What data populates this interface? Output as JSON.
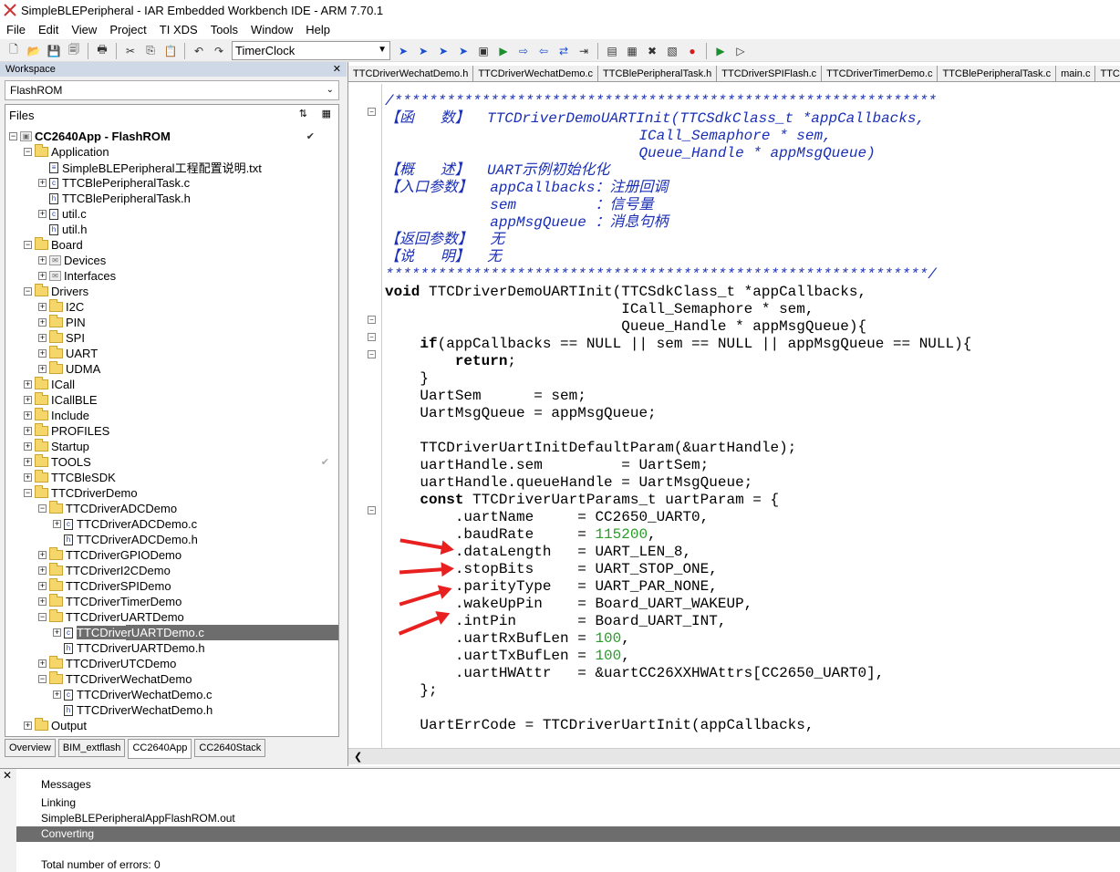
{
  "window": {
    "title": "SimpleBLEPeripheral - IAR Embedded Workbench IDE - ARM 7.70.1"
  },
  "menu": [
    "File",
    "Edit",
    "View",
    "Project",
    "TI XDS",
    "Tools",
    "Window",
    "Help"
  ],
  "toolbar": {
    "combo_value": "TimerClock"
  },
  "workspace": {
    "title": "Workspace",
    "config": "FlashROM",
    "files_header": "Files",
    "project": "CC2640App - FlashROM",
    "tabs": [
      "Overview",
      "BIM_extflash",
      "CC2640App",
      "CC2640Stack"
    ],
    "tree": [
      {
        "label": "Application",
        "level": 1,
        "type": "folder",
        "exp": "-"
      },
      {
        "label": "SimpleBLEPeripheral工程配置说明.txt",
        "level": 2,
        "type": "file",
        "exp": ""
      },
      {
        "label": "TTCBlePeripheralTask.c",
        "level": 2,
        "type": "file",
        "exp": "+"
      },
      {
        "label": "TTCBlePeripheralTask.h",
        "level": 2,
        "type": "file",
        "exp": ""
      },
      {
        "label": "util.c",
        "level": 2,
        "type": "file",
        "exp": "+"
      },
      {
        "label": "util.h",
        "level": 2,
        "type": "file",
        "exp": ""
      },
      {
        "label": "Board",
        "level": 1,
        "type": "folder",
        "exp": "-"
      },
      {
        "label": "Devices",
        "level": 2,
        "type": "group",
        "exp": "+"
      },
      {
        "label": "Interfaces",
        "level": 2,
        "type": "group",
        "exp": "+"
      },
      {
        "label": "Drivers",
        "level": 1,
        "type": "folder",
        "exp": "-"
      },
      {
        "label": "I2C",
        "level": 2,
        "type": "folder",
        "exp": "+"
      },
      {
        "label": "PIN",
        "level": 2,
        "type": "folder",
        "exp": "+"
      },
      {
        "label": "SPI",
        "level": 2,
        "type": "folder",
        "exp": "+"
      },
      {
        "label": "UART",
        "level": 2,
        "type": "folder",
        "exp": "+"
      },
      {
        "label": "UDMA",
        "level": 2,
        "type": "folder",
        "exp": "+"
      },
      {
        "label": "ICall",
        "level": 1,
        "type": "folder",
        "exp": "+"
      },
      {
        "label": "ICallBLE",
        "level": 1,
        "type": "folder",
        "exp": "+"
      },
      {
        "label": "Include",
        "level": 1,
        "type": "folder",
        "exp": "+"
      },
      {
        "label": "PROFILES",
        "level": 1,
        "type": "folder",
        "exp": "+"
      },
      {
        "label": "Startup",
        "level": 1,
        "type": "folder",
        "exp": "+"
      },
      {
        "label": "TOOLS",
        "level": 1,
        "type": "folder",
        "exp": "+"
      },
      {
        "label": "TTCBleSDK",
        "level": 1,
        "type": "folder",
        "exp": "+"
      },
      {
        "label": "TTCDriverDemo",
        "level": 1,
        "type": "folder",
        "exp": "-"
      },
      {
        "label": "TTCDriverADCDemo",
        "level": 2,
        "type": "folder",
        "exp": "-"
      },
      {
        "label": "TTCDriverADCDemo.c",
        "level": 3,
        "type": "file",
        "exp": "+"
      },
      {
        "label": "TTCDriverADCDemo.h",
        "level": 3,
        "type": "file",
        "exp": ""
      },
      {
        "label": "TTCDriverGPIODemo",
        "level": 2,
        "type": "folder",
        "exp": "+"
      },
      {
        "label": "TTCDriverI2CDemo",
        "level": 2,
        "type": "folder",
        "exp": "+"
      },
      {
        "label": "TTCDriverSPIDemo",
        "level": 2,
        "type": "folder",
        "exp": "+"
      },
      {
        "label": "TTCDriverTimerDemo",
        "level": 2,
        "type": "folder",
        "exp": "+"
      },
      {
        "label": "TTCDriverUARTDemo",
        "level": 2,
        "type": "folder",
        "exp": "-"
      },
      {
        "label": "TTCDriverUARTDemo.c",
        "level": 3,
        "type": "file",
        "exp": "+",
        "selected": true
      },
      {
        "label": "TTCDriverUARTDemo.h",
        "level": 3,
        "type": "file",
        "exp": ""
      },
      {
        "label": "TTCDriverUTCDemo",
        "level": 2,
        "type": "folder",
        "exp": "+"
      },
      {
        "label": "TTCDriverWechatDemo",
        "level": 2,
        "type": "folder",
        "exp": "-"
      },
      {
        "label": "TTCDriverWechatDemo.c",
        "level": 3,
        "type": "file",
        "exp": "+"
      },
      {
        "label": "TTCDriverWechatDemo.h",
        "level": 3,
        "type": "file",
        "exp": ""
      },
      {
        "label": "Output",
        "level": 1,
        "type": "folder",
        "exp": "+"
      }
    ]
  },
  "editor": {
    "tabs": [
      "TTCDriverWechatDemo.h",
      "TTCDriverWechatDemo.c",
      "TTCBlePeripheralTask.h",
      "TTCDriverSPIFlash.c",
      "TTCDriverTimerDemo.c",
      "TTCBlePeripheralTask.c",
      "main.c",
      "TTCDriverTim"
    ],
    "lines": [
      {
        "t": "/**************************************************************",
        "c": "cm"
      },
      {
        "t": "【函   数】  TTCDriverDemoUARTInit(TTCSdkClass_t *appCallbacks,",
        "c": "cm"
      },
      {
        "t": "                             ICall_Semaphore * sem,",
        "c": "cm"
      },
      {
        "t": "                             Queue_Handle * appMsgQueue)",
        "c": "cm"
      },
      {
        "t": "【概   述】  UART示例初始化化",
        "c": "cm"
      },
      {
        "t": "【入口参数】  appCallbacks：注册回调",
        "c": "cm"
      },
      {
        "t": "            sem         ：信号量",
        "c": "cm"
      },
      {
        "t": "            appMsgQueue ：消息句柄",
        "c": "cm"
      },
      {
        "t": "【返回参数】  无",
        "c": "cm"
      },
      {
        "t": "【说   明】  无",
        "c": "cm"
      },
      {
        "t": "**************************************************************/",
        "c": "cm"
      },
      {
        "t": "void TTCDriverDemoUARTInit(TTCSdkClass_t *appCallbacks,",
        "c": "kwv"
      },
      {
        "t": "                           ICall_Semaphore * sem,",
        "c": ""
      },
      {
        "t": "                           Queue_Handle * appMsgQueue){",
        "c": ""
      },
      {
        "t": "    if(appCallbacks == NULL || sem == NULL || appMsgQueue == NULL){",
        "c": ""
      },
      {
        "t": "        return;",
        "c": "kwr"
      },
      {
        "t": "    }",
        "c": ""
      },
      {
        "t": "    UartSem      = sem;",
        "c": ""
      },
      {
        "t": "    UartMsgQueue = appMsgQueue;",
        "c": ""
      },
      {
        "t": "",
        "c": ""
      },
      {
        "t": "    TTCDriverUartInitDefaultParam(&uartHandle);",
        "c": ""
      },
      {
        "t": "    uartHandle.sem         = UartSem;",
        "c": ""
      },
      {
        "t": "    uartHandle.queueHandle = UartMsgQueue;",
        "c": ""
      },
      {
        "t": "    const TTCDriverUartParams_t uartParam = {",
        "c": "kwc"
      },
      {
        "t": "        .uartName     = CC2650_UART0,",
        "c": ""
      },
      {
        "t": "        .baudRate     = ",
        "c": "num",
        "n": "115200",
        "tail": ","
      },
      {
        "t": "        .dataLength   = UART_LEN_8,",
        "c": ""
      },
      {
        "t": "        .stopBits     = UART_STOP_ONE,",
        "c": ""
      },
      {
        "t": "        .parityType   = UART_PAR_NONE,",
        "c": ""
      },
      {
        "t": "        .wakeUpPin    = Board_UART_WAKEUP,",
        "c": ""
      },
      {
        "t": "        .intPin       = Board_UART_INT,",
        "c": ""
      },
      {
        "t": "        .uartRxBufLen = ",
        "c": "num",
        "n": "100",
        "tail": ","
      },
      {
        "t": "        .uartTxBufLen = ",
        "c": "num",
        "n": "100",
        "tail": ","
      },
      {
        "t": "        .uartHWAttr   = &uartCC26XXHWAttrs[CC2650_UART0],",
        "c": ""
      },
      {
        "t": "    };",
        "c": ""
      },
      {
        "t": "",
        "c": ""
      },
      {
        "t": "    UartErrCode = TTCDriverUartInit(appCallbacks,",
        "c": ""
      }
    ]
  },
  "messages": {
    "header": "Messages",
    "rows": [
      "Linking",
      "SimpleBLEPeripheralAppFlashROM.out",
      "Converting",
      "",
      "Total number of errors: 0"
    ]
  }
}
